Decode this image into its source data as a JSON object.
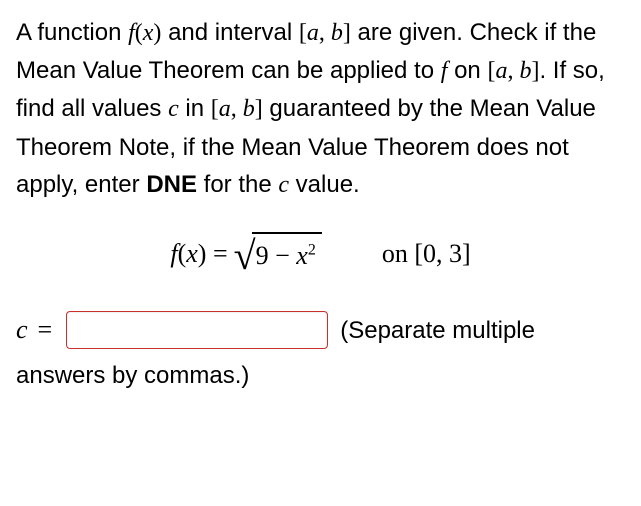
{
  "prompt": {
    "p1a": "A function ",
    "p1b": "f",
    "p1c": "(",
    "p1d": "x",
    "p1e": ")",
    "p1f": " and interval ",
    "p1g": "[",
    "p1h": "a",
    "p1i": ", ",
    "p1j": "b",
    "p1k": "]",
    "p1l": " are given. Check if the Mean Value Theorem can be applied to ",
    "p1m": "f",
    "p1n": " on ",
    "p1o": "[",
    "p1p": "a",
    "p1q": ", ",
    "p1r": "b",
    "p1s": "]",
    "p1t": ". If so, find all values ",
    "p1u": "c",
    "p1v": " in ",
    "p1w": "[",
    "p1x": "a",
    "p1y": ", ",
    "p1z": "b",
    "p1aa": "]",
    "p1ab": " guaranteed by the Mean Value Theorem Note, if the Mean Value Theorem does not apply, enter ",
    "p1ac": "DNE",
    "p1ad": " for the ",
    "p1ae": "c",
    "p1af": " value."
  },
  "equation": {
    "lhs_f": "f",
    "lhs_paren_open": "(",
    "lhs_x": "x",
    "lhs_paren_close": ")",
    "eq": " = ",
    "nine": "9",
    "minus": " − ",
    "x": "x",
    "sq": "2",
    "on": "on ",
    "interval": "[0, 3]"
  },
  "answer": {
    "var": "c",
    "eq": " = ",
    "value": "",
    "suffix": "(Separate multiple",
    "note": "answers by commas.)"
  }
}
